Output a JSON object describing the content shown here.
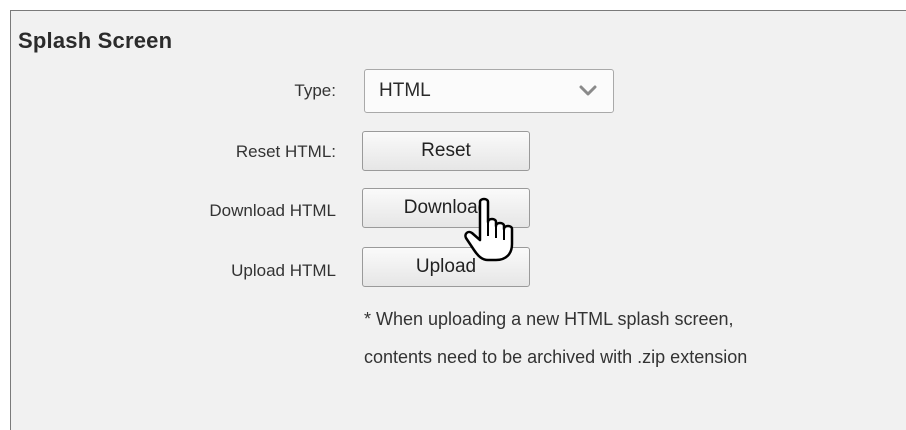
{
  "section": {
    "title": "Splash Screen"
  },
  "type_row": {
    "label": "Type:",
    "value": "HTML"
  },
  "reset_row": {
    "label": "Reset HTML:",
    "button": "Reset"
  },
  "download_row": {
    "label": "Download HTML",
    "button": "Download"
  },
  "upload_row": {
    "label": "Upload HTML",
    "button": "Upload"
  },
  "note": {
    "line1": "* When uploading a new HTML splash screen,",
    "line2": "contents need to be archived with .zip extension"
  },
  "icons": {
    "dropdown": "chevron-down-icon",
    "cursor": "hand-pointer-icon"
  },
  "colors": {
    "panel_bg": "#f1f1f1",
    "button_border": "#9a9a9a",
    "text": "#333333"
  }
}
